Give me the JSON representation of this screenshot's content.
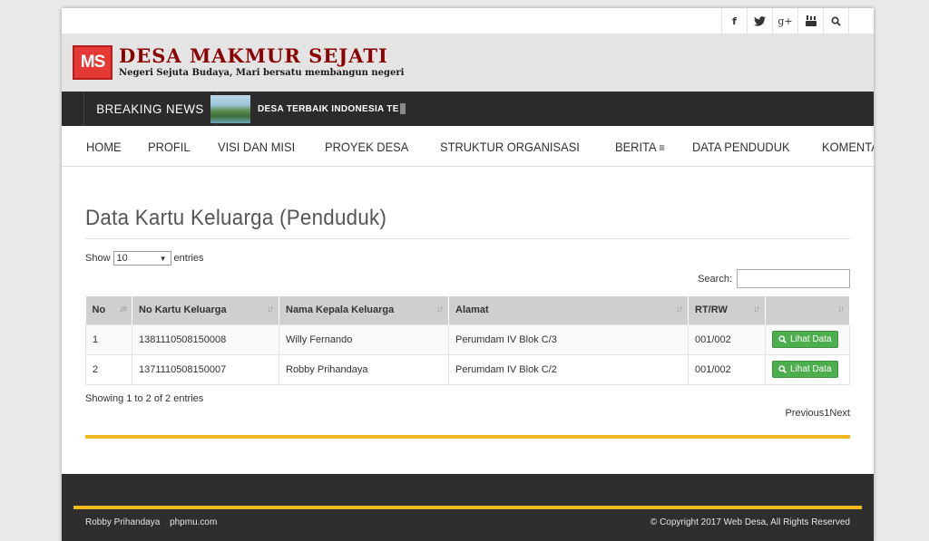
{
  "social": {
    "facebook": "f",
    "twitter": "twitter-bird",
    "gplus": "g+",
    "youtube": "youtube",
    "search": "search"
  },
  "header": {
    "logo_text": "MS",
    "site_title": "DESA MAKMUR SEJATI",
    "tagline": "Negeri Sejuta Budaya, Mari bersatu membangun negeri"
  },
  "breaking": {
    "label": "BREAKING NEWS",
    "headline": "DESA TERBAIK INDONESIA TE"
  },
  "nav": {
    "items": [
      "HOME",
      "PROFIL",
      "VISI DAN MISI",
      "PROYEK DESA",
      "STRUKTUR ORGANISASI",
      "BERITA",
      "DATA PENDUDUK",
      "KOMENTAR DAN SARAN"
    ],
    "berita_icon": "≡"
  },
  "content": {
    "heading": "Data Kartu Keluarga (Penduduk)",
    "show_label": "Show",
    "entries_value": "10",
    "entries_label": "entries",
    "search_label": "Search:",
    "search_value": "",
    "columns": [
      "No",
      "No Kartu Keluarga",
      "Nama Kepala Keluarga",
      "Alamat",
      "RT/RW",
      ""
    ],
    "rows": [
      {
        "no": "1",
        "kk": "1381110508150008",
        "nama": "Willy Fernando",
        "alamat": "Perumdam IV Blok C/3",
        "rtrw": "001/002",
        "action": "Lihat Data"
      },
      {
        "no": "2",
        "kk": "1371110508150007",
        "nama": "Robby Prihandaya",
        "alamat": "Perumdam IV Blok C/2",
        "rtrw": "001/002",
        "action": "Lihat Data"
      }
    ],
    "showing": "Showing 1 to 2 of 2 entries",
    "pager": {
      "prev": "Previous",
      "page": "1",
      "next": "Next"
    }
  },
  "footer": {
    "author": "Robby Prihandaya",
    "site": "phpmu.com",
    "copyright": "© Copyright 2017 Web Desa, All Rights Reserved"
  },
  "colors": {
    "accent": "#f0b820",
    "button_green": "#4cae4c",
    "dark_bar": "#2b2b2b",
    "logo_red": "#e53935"
  }
}
